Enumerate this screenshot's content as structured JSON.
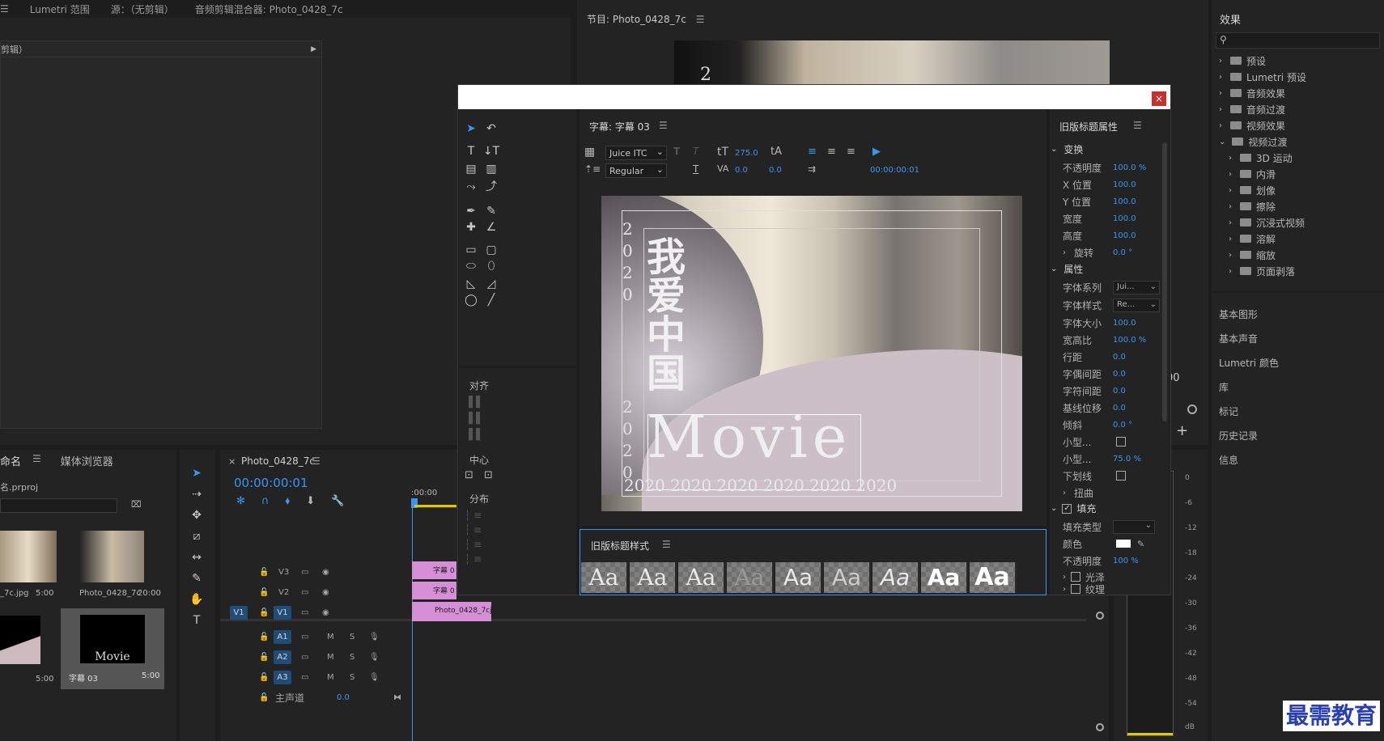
{
  "source_panel": {
    "tabs": [
      "Lumetri 范围",
      "源：（无剪辑）",
      "音频剪辑混合器: Photo_0428_7c"
    ],
    "label": "剪辑）"
  },
  "program_monitor": {
    "title": "节目: Photo_0428_7c",
    "timecode_frag": "00"
  },
  "project_panel": {
    "tabs": [
      "命名",
      "媒体浏览器"
    ],
    "file": "名.prproj",
    "items": [
      {
        "name": "_7c.jpg",
        "dur": "5:00"
      },
      {
        "name": "Photo_0428_7c",
        "dur": "20:00"
      },
      {
        "name": "",
        "dur": "5:00"
      },
      {
        "name": "字幕 03",
        "dur": "5:00"
      }
    ]
  },
  "timeline": {
    "tab": "Photo_0428_7c",
    "timecode": "00:00:00:01",
    "ruler_start": ":00:00",
    "tracks_video": [
      "V3",
      "V2",
      "V1"
    ],
    "tracks_audio": [
      "A1",
      "A2",
      "A3"
    ],
    "v1_source": "V1",
    "master": "主声道",
    "master_val": "0.0",
    "mute": "M",
    "solo": "S",
    "clips": [
      "字幕 0",
      "字幕 0",
      "Photo_0428_7cj"
    ]
  },
  "dialog": {
    "title_tab": "字幕: 字幕 03",
    "font_family": "Juice ITC",
    "font_style": "Regular",
    "font_size": "275.0",
    "kerning": "0.0",
    "leading": "0.0",
    "timecode": "00:00:00:01",
    "align_label": "对齐",
    "center_label": "中心",
    "distribute_label": "分布",
    "styles_title": "旧版标题样式",
    "style_sample": "Aa",
    "canvas_text": {
      "year_col": "2020",
      "year_col2": "2020",
      "movie": "Movie",
      "row": "2020 2020 2020 2020 2020 2020",
      "calligraphy": "我爱中国"
    },
    "props_title": "旧版标题属性",
    "sections": {
      "transform": "变换",
      "properties": "属性",
      "fill": "填充"
    },
    "props": [
      {
        "label": "不透明度",
        "value": "100.0 %"
      },
      {
        "label": "X 位置",
        "value": "100.0"
      },
      {
        "label": "Y 位置",
        "value": "100.0"
      },
      {
        "label": "宽度",
        "value": "100.0"
      },
      {
        "label": "高度",
        "value": "100.0"
      },
      {
        "label": "旋转",
        "value": "0.0 °"
      }
    ],
    "attrs": [
      {
        "label": "字体系列",
        "value": "Jui..."
      },
      {
        "label": "字体样式",
        "value": "Re..."
      },
      {
        "label": "字体大小",
        "value": "100.0"
      },
      {
        "label": "宽高比",
        "value": "100.0 %"
      },
      {
        "label": "行距",
        "value": "0.0"
      },
      {
        "label": "字偶间距",
        "value": "0.0"
      },
      {
        "label": "字符间距",
        "value": "0.0"
      },
      {
        "label": "基线位移",
        "value": "0.0"
      },
      {
        "label": "倾斜",
        "value": "0.0 °"
      },
      {
        "label": "小型...",
        "value": ""
      },
      {
        "label": "小型...",
        "value": "75.0 %"
      },
      {
        "label": "下划线",
        "value": ""
      },
      {
        "label": "扭曲",
        "value": ""
      }
    ],
    "fill": [
      {
        "label": "填充类型",
        "value": ""
      },
      {
        "label": "颜色",
        "value": ""
      },
      {
        "label": "不透明度",
        "value": "100 %"
      },
      {
        "label": "光泽",
        "value": ""
      },
      {
        "label": "纹理",
        "value": ""
      }
    ]
  },
  "effects": {
    "title": "效果",
    "items": [
      "预设",
      "Lumetri 预设",
      "音频效果",
      "音频过渡",
      "视频效果",
      "视频过渡"
    ],
    "sub": [
      "3D 运动",
      "内滑",
      "划像",
      "擦除",
      "沉浸式视频",
      "溶解",
      "缩放",
      "页面剥落"
    ],
    "panels": [
      "基本图形",
      "基本声音",
      "Lumetri 颜色",
      "库",
      "标记",
      "历史记录",
      "信息"
    ]
  },
  "meter": {
    "ticks": [
      "0",
      "-6",
      "-12",
      "-18",
      "-24",
      "-30",
      "-36",
      "-42",
      "-48",
      "-54",
      "dB"
    ]
  },
  "watermark": "最需教育"
}
